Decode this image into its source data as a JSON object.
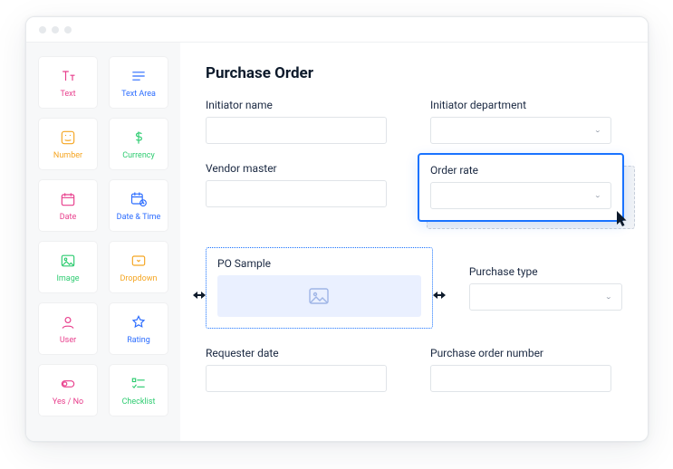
{
  "palette": {
    "text": {
      "label": "Text",
      "color": "magenta"
    },
    "textarea": {
      "label": "Text Area",
      "color": "blue"
    },
    "number": {
      "label": "Number",
      "color": "orange"
    },
    "currency": {
      "label": "Currency",
      "color": "green"
    },
    "date": {
      "label": "Date",
      "color": "magenta"
    },
    "datetime": {
      "label": "Date & Time",
      "color": "blue"
    },
    "image": {
      "label": "Image",
      "color": "green"
    },
    "dropdown": {
      "label": "Dropdown",
      "color": "orange"
    },
    "user": {
      "label": "User",
      "color": "magenta"
    },
    "rating": {
      "label": "Rating",
      "color": "blue"
    },
    "yesno": {
      "label": "Yes / No",
      "color": "magenta"
    },
    "checklist": {
      "label": "Checklist",
      "color": "green"
    }
  },
  "form": {
    "title": "Purchase Order",
    "fields": {
      "initiator_name": {
        "label": "Initiator name",
        "type": "text"
      },
      "initiator_department": {
        "label": "Initiator department",
        "type": "select"
      },
      "vendor_master": {
        "label": "Vendor master",
        "type": "text"
      },
      "order_rate": {
        "label": "Order rate",
        "type": "select"
      },
      "po_sample": {
        "label": "PO Sample",
        "type": "image"
      },
      "purchase_type": {
        "label": "Purchase type",
        "type": "select"
      },
      "requester_date": {
        "label": "Requester date",
        "type": "text"
      },
      "purchase_order_number": {
        "label": "Purchase order number",
        "type": "text"
      }
    }
  }
}
